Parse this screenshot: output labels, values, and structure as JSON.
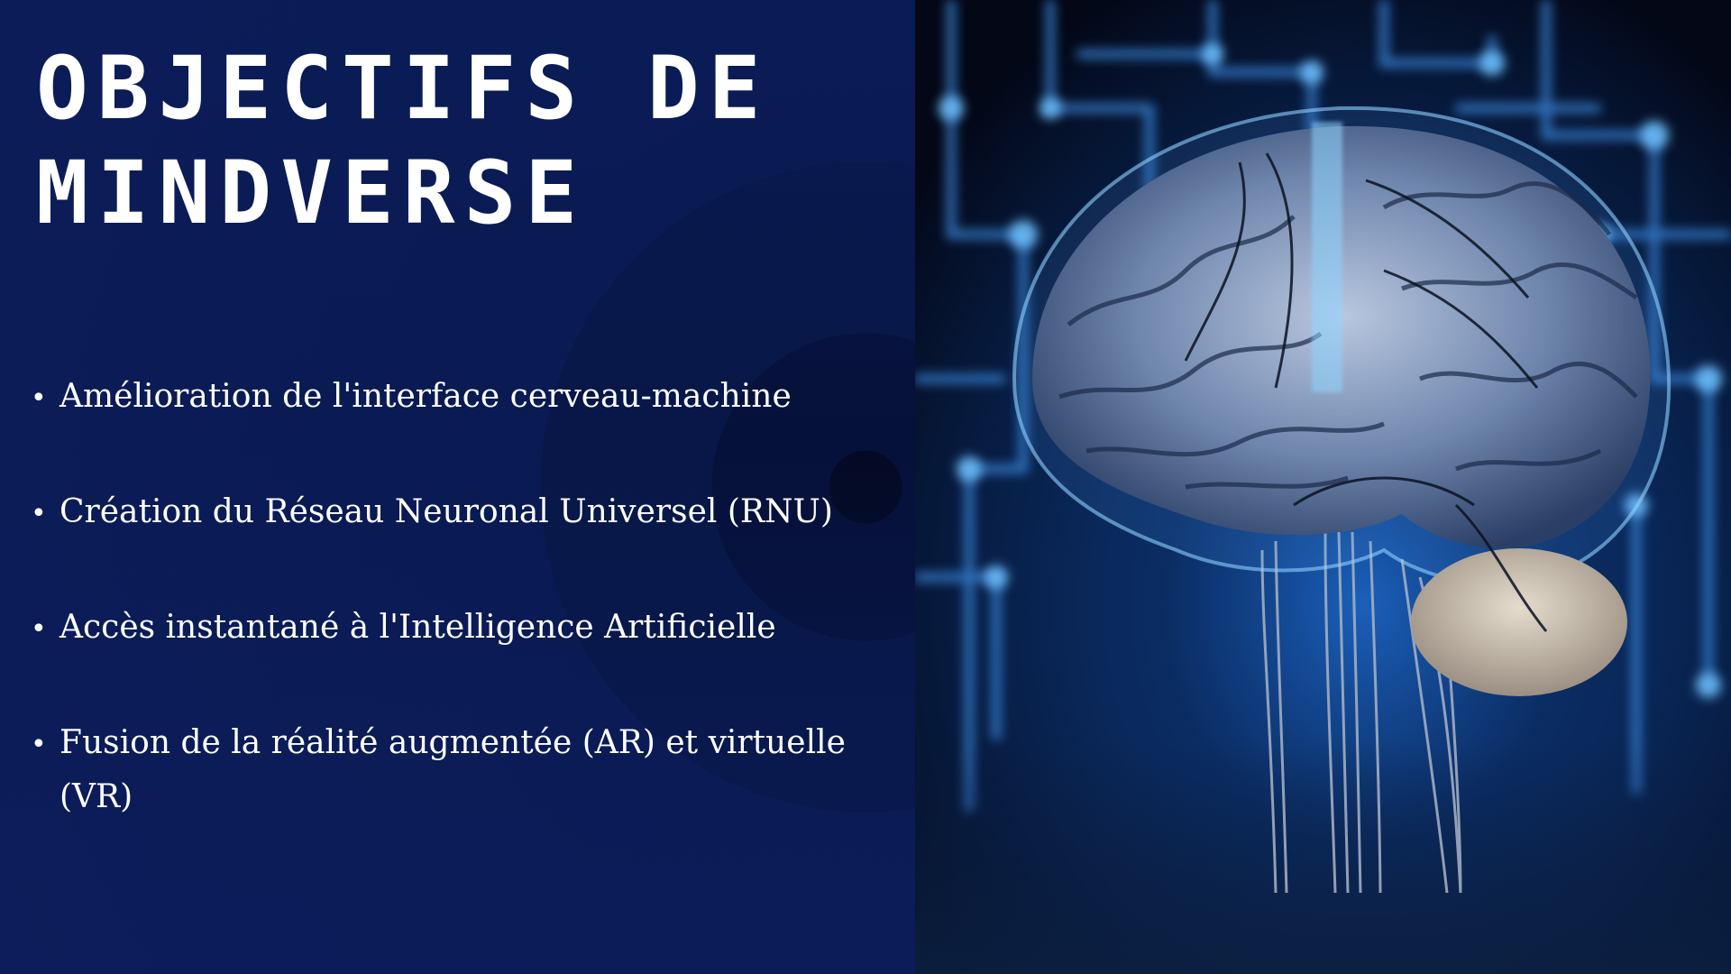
{
  "slide": {
    "title": "OBJECTIFS DE\nMINDVERSE",
    "bullets": [
      "Amélioration de l'interface cerveau-machine",
      "Création du Réseau Neuronal Universel (RNU)",
      "Accès instantané à l'Intelligence Artificielle",
      "Fusion de la réalité augmentée (AR) et virtuelle (VR)"
    ],
    "bullet_glyph": "•"
  },
  "image": {
    "subject": "brain-circuit-illustration",
    "colors": {
      "background_dark": "#050b1d",
      "circuit_blue": "#3c8fe6",
      "glow_blue": "#6fc2ff",
      "brain_tone": "#8aa3c9"
    }
  }
}
